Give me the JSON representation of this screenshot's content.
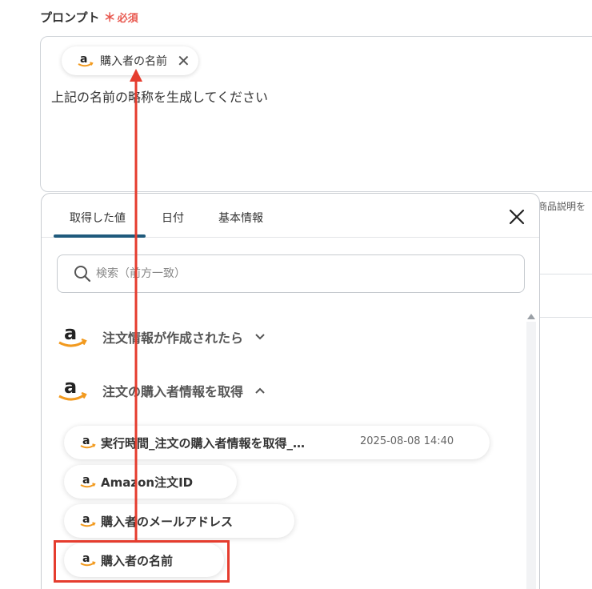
{
  "field": {
    "label": "プロンプト",
    "required_mark": "＊",
    "required_text": "必須"
  },
  "prompt": {
    "chip_label": "購入者の名前",
    "chip_close": "✕",
    "text": "上記の名前の略称を生成してください"
  },
  "behind": {
    "partial_text": "商品説明を"
  },
  "panel": {
    "tabs": [
      "取得した値",
      "日付",
      "基本情報"
    ],
    "active_tab": 0,
    "search_placeholder": "検索（前方一致）",
    "groups": [
      {
        "label": "注文情報が作成されたら",
        "expanded": false
      },
      {
        "label": "注文の購入者情報を取得",
        "expanded": true
      }
    ],
    "items": [
      {
        "label": "実行時間_注文の購入者情報を取得_…",
        "meta": "2025-08-08 14:40"
      },
      {
        "label": "Amazon注文ID",
        "meta": ""
      },
      {
        "label": "購入者のメールアドレス",
        "meta": ""
      },
      {
        "label": "購入者の名前",
        "meta": ""
      }
    ]
  },
  "annotation": {
    "color": "#e53c2e"
  },
  "colors": {
    "accent": "#1f5a7c",
    "required": "#e8584f",
    "amazon_arrow": "#f29a1f"
  },
  "icons": [
    "amazon-logo-icon",
    "close-icon",
    "search-icon",
    "chevron-down-icon",
    "chevron-up-icon"
  ]
}
